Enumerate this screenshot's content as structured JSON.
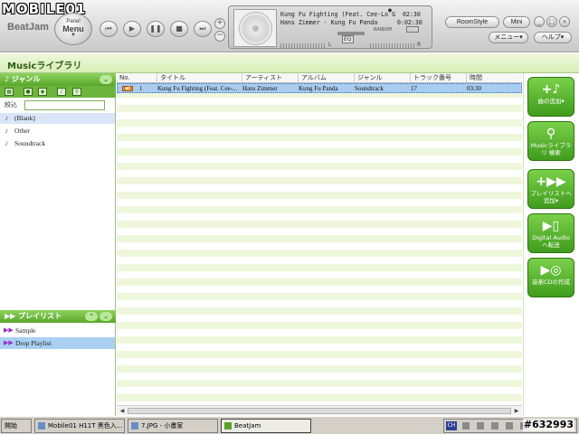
{
  "watermark": {
    "text": "MOBILE01"
  },
  "app": {
    "name": "BeatJam",
    "panel_menu_small": "Panel",
    "panel_menu_big": "Menu"
  },
  "player": {
    "title": "Kung Fu Fighting (Feat. Cee-Lo Gre..",
    "artist_album": "Hans Zimmer - Kung Fu Panda",
    "elapsed": "02:30",
    "remaining": "0:02:30",
    "random_label": "RANDOM",
    "eq_label": "EQ",
    "left_label": "L",
    "right_label": "R"
  },
  "top_buttons": {
    "room_style": "RoomStyle",
    "mini": "Mini",
    "menu": "メニュー▾",
    "help": "ヘルプ▾"
  },
  "library": {
    "title": "Musicライブラリ"
  },
  "genre_panel": {
    "title": "ジャンル",
    "filter_label": "絞込",
    "items": [
      "(Blank)",
      "Other",
      "Soundtrack"
    ]
  },
  "playlist_panel": {
    "title": "プレイリスト",
    "items": [
      "Sample",
      "Drop Playlist"
    ]
  },
  "table": {
    "columns": [
      "No.",
      "タイトル",
      "アーティスト",
      "アルバム",
      "ジャンル",
      "トラック番号",
      "時間"
    ],
    "rows": [
      {
        "no": "1",
        "title": "Kung Fu Fighting (Feat. Cee-...",
        "artist": "Hans Zimmer",
        "album": "Kung Fu Panda",
        "genre": "Soundtrack",
        "track": "17",
        "time": "03:30"
      }
    ]
  },
  "actions": [
    {
      "label": "曲の追加▾",
      "icon": "plus-note-icon"
    },
    {
      "label": "Musicライブラリ 検索",
      "icon": "magnifier-icon"
    },
    {
      "label": "プレイリストへ 追加▾",
      "icon": "forward-arrows-icon"
    },
    {
      "label": "Digital Audio へ転送",
      "icon": "device-transfer-icon"
    },
    {
      "label": "音楽CDの作成",
      "icon": "cd-burn-icon"
    }
  ],
  "taskbar": {
    "start": "開始",
    "tasks": [
      "Mobile01 H11T 黑色入...",
      "7.JPG - 小畫家",
      "BeatJam"
    ],
    "tray_lang": "CH",
    "badge": "#632993"
  }
}
